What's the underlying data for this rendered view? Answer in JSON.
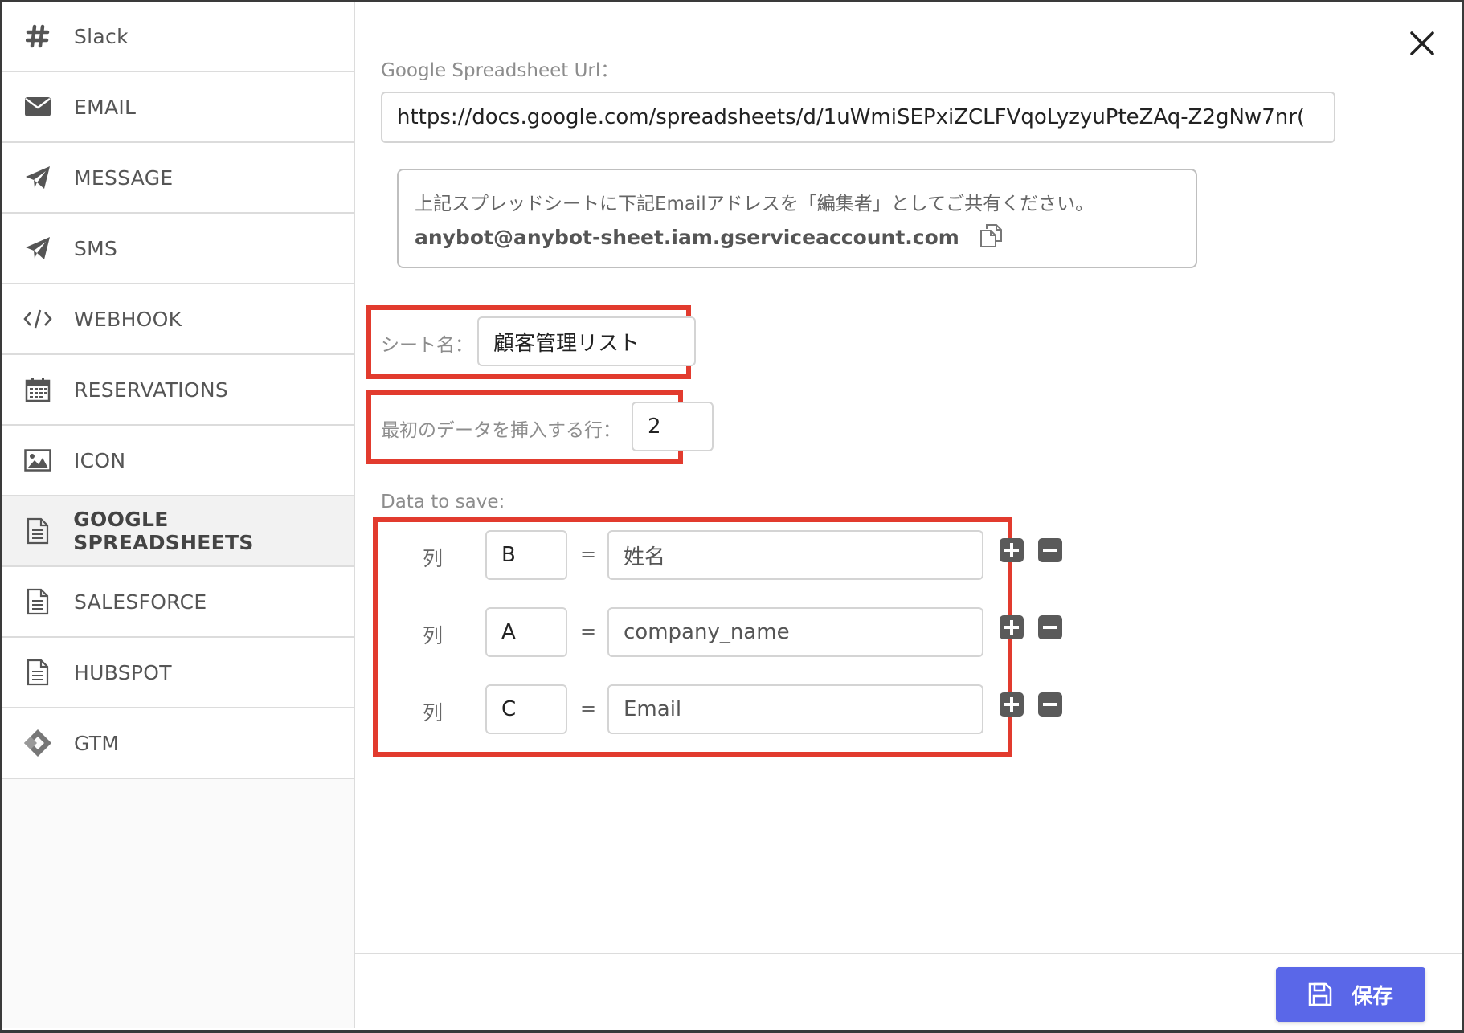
{
  "sidebar": {
    "items": [
      {
        "label": "Slack",
        "icon": "hashtag-icon"
      },
      {
        "label": "EMAIL",
        "icon": "envelope-icon"
      },
      {
        "label": "MESSAGE",
        "icon": "paper-plane-icon"
      },
      {
        "label": "SMS",
        "icon": "paper-plane-icon"
      },
      {
        "label": "WEBHOOK",
        "icon": "code-icon"
      },
      {
        "label": "RESERVATIONS",
        "icon": "calendar-icon"
      },
      {
        "label": "ICON",
        "icon": "image-icon"
      },
      {
        "label": "GOOGLE SPREADSHEETS",
        "icon": "document-icon",
        "active": true
      },
      {
        "label": "SALESFORCE",
        "icon": "document-icon"
      },
      {
        "label": "HUBSPOT",
        "icon": "document-icon"
      },
      {
        "label": "GTM",
        "icon": "gtm-diamond-icon"
      }
    ]
  },
  "form": {
    "url_label": "Google Spreadsheet Url：",
    "url_value": "https://docs.google.com/spreadsheets/d/1uWmiSEPxiZCLFVqoLyzyuPteZAq-Z2gNw7nr(",
    "notice_text": "上記スプレッドシートに下記Emailアドレスを「編集者」としてご共有ください。",
    "notice_email": "anybot@anybot-sheet.iam.gserviceaccount.com",
    "sheet_label": "シート名：",
    "sheet_value": "顧客管理リスト",
    "row_label": "最初のデータを挿入する行：",
    "row_value": "2",
    "data_label": "Data to save:",
    "mappings": [
      {
        "col_label": "列",
        "column": "B",
        "eq": "=",
        "field": "姓名"
      },
      {
        "col_label": "列",
        "column": "A",
        "eq": "=",
        "field": "company_name"
      },
      {
        "col_label": "列",
        "column": "C",
        "eq": "=",
        "field": "Email"
      }
    ]
  },
  "footer": {
    "save_label": "保存"
  },
  "colors": {
    "highlight": "#e23b2e",
    "primary_button": "#5a67e8"
  }
}
